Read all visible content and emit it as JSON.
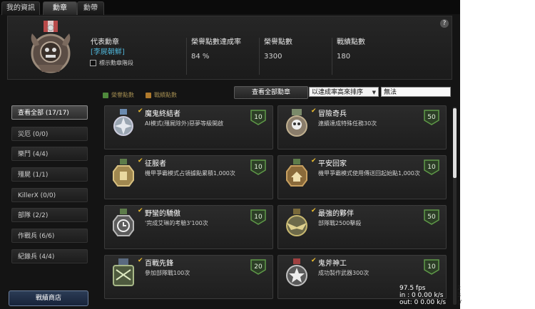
{
  "tabs": [
    {
      "label": "我的資訊"
    },
    {
      "label": "勳章"
    },
    {
      "label": "勳帶"
    }
  ],
  "help": {
    "label": "?"
  },
  "header": {
    "rep_label": "代表勳章",
    "rep_value": "[李屍朝鮮]",
    "rate_label": "榮譽點數達成率",
    "rate_value": "84 %",
    "honor_label": "榮譽點數",
    "honor_value": "3300",
    "battle_label": "戰績點數",
    "battle_value": "180",
    "show_rank": "標示勳章階段"
  },
  "sidebar": {
    "items": [
      {
        "label": "查看全部 (17/17)",
        "active": true
      },
      {
        "label": "災厄 (0/0)"
      },
      {
        "label": "樂鬥 (4/4)"
      },
      {
        "label": "殭屍 (1/1)"
      },
      {
        "label": "KillerX (0/0)"
      },
      {
        "label": "部隊 (2/2)"
      },
      {
        "label": "作戰兵 (6/6)"
      },
      {
        "label": "紀錄兵 (4/4)"
      }
    ],
    "shop": "戰績商店"
  },
  "legend": {
    "honor": "榮譽點數",
    "battle": "戰績點數",
    "honor_color": "#4f8a3c",
    "battle_color": "#b07a2c"
  },
  "toolbar": {
    "view_all": "查看全部勳章",
    "sort": "以達成率高來排序",
    "filter": "無法"
  },
  "medals": [
    {
      "title": "魔鬼終結者",
      "desc": "AI模式(殭屍除外)惡夢等級開啟",
      "points": "10",
      "type": "honor",
      "icon": "silver-cross-medal"
    },
    {
      "title": "冒險奇兵",
      "desc": "連續達成特殊任務30次",
      "points": "50",
      "type": "honor",
      "icon": "skull-medal"
    },
    {
      "title": "征服者",
      "desc": "機甲爭霸模式占領據點累積1,000次",
      "points": "10",
      "type": "honor",
      "icon": "gold-octagon-medal"
    },
    {
      "title": "平安回家",
      "desc": "機甲爭霸模式使用傳送回起始點1,000次",
      "points": "10",
      "type": "honor",
      "icon": "house-medal"
    },
    {
      "title": "野蠻的驕傲",
      "desc": "'完成艾琳的考驗3'100次",
      "points": "10",
      "type": "honor",
      "icon": "clock-medal"
    },
    {
      "title": "最強的夥伴",
      "desc": "部隊戰2500擊殺",
      "points": "50",
      "type": "honor",
      "icon": "eagle-medal"
    },
    {
      "title": "百戰先鋒",
      "desc": "參加部隊戰100次",
      "points": "20",
      "type": "honor",
      "icon": "100th-medal"
    },
    {
      "title": "鬼斧神工",
      "desc": "成功製作武器300次",
      "points": "10",
      "type": "honor",
      "icon": "star-medal"
    }
  ],
  "overlay": {
    "fps": "97.5 fps",
    "in": "in : 0 0.00 k/s",
    "out": "out: 0 0.00 k/s"
  },
  "edge": {
    "a": "2",
    "b": "3",
    "c": "(/"
  }
}
